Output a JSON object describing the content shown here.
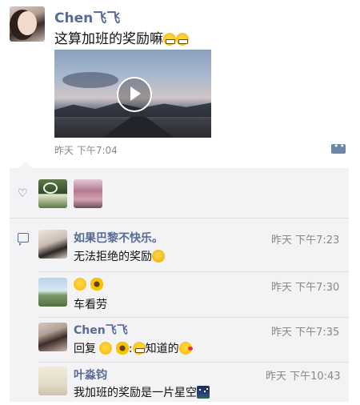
{
  "post": {
    "author": "Chen飞飞",
    "text": "这算加班的奖励嘛",
    "text_emojis": [
      "grinning-face-icon",
      "grinning-face-icon"
    ],
    "time": "昨天 下午7:04"
  },
  "likes": [
    "like-avatar-1",
    "like-avatar-2"
  ],
  "comments": [
    {
      "name": "如果巴黎不快乐。",
      "time": "昨天 下午7:23",
      "text": "无法拒绝的奖励"
    },
    {
      "name": "",
      "time": "昨天 下午7:30",
      "text": "车看劳"
    },
    {
      "name": "Chen飞飞",
      "time": "昨天 下午7:35",
      "text_prefix": "回复",
      "text_mid": ":",
      "text_suffix": "知道的"
    },
    {
      "name": "叶淼钧",
      "time": "昨天 下午10:43",
      "text": "我加班的奖励是一片星空"
    }
  ],
  "colors": {
    "name": "#576b95",
    "panel": "#f3f3f5"
  }
}
